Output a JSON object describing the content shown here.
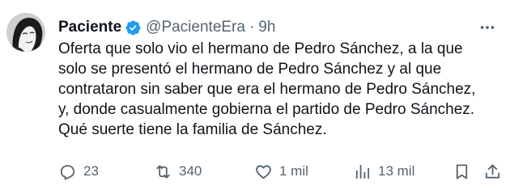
{
  "author": {
    "display_name": "Paciente",
    "handle": "@PacienteEra",
    "separator": "·",
    "time": "9h",
    "verified_color": "#1d9bf0"
  },
  "tweet": {
    "lines": [
      "Oferta que solo vio el hermano de Pedro Sánchez, a la que",
      "solo se presentó el hermano de Pedro Sánchez y al que",
      "contrataron sin saber que era el hermano de Pedro Sánchez,",
      "y, donde casualmente gobierna el partido de Pedro Sánchez.",
      "Qué suerte tiene la familia de Sánchez."
    ]
  },
  "actions": {
    "replies": "23",
    "reposts": "340",
    "likes": "1 mil",
    "views": "13 mil"
  },
  "icons": {
    "more": "more-horizontal-icon",
    "reply": "reply-icon",
    "repost": "repost-icon",
    "like": "heart-icon",
    "views": "views-chart-icon",
    "bookmark": "bookmark-icon",
    "share": "share-icon"
  }
}
